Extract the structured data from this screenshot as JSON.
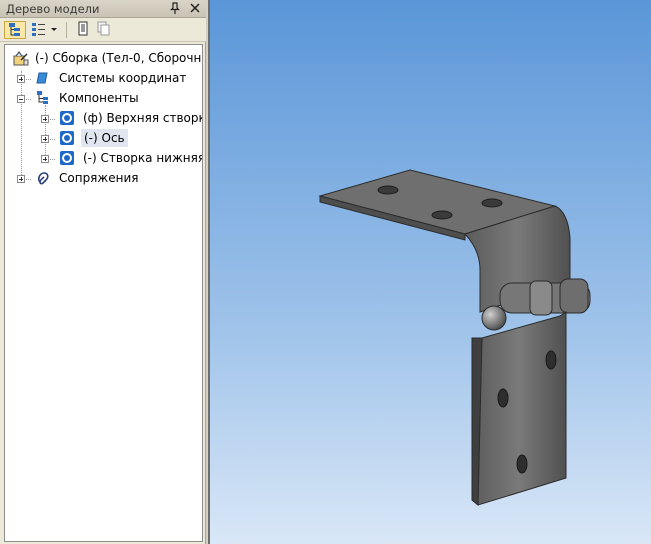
{
  "panel": {
    "title": "Дерево модели",
    "pin_icon": "pin-icon",
    "close_icon": "close-icon",
    "toolbar": {
      "tree_view_icon": "tree-structure-icon",
      "list_view_icon": "list-view-icon",
      "dropdown_icon": "chevron-down-icon",
      "properties_icon": "document-icon",
      "copy_icon": "document-copy-icon"
    }
  },
  "tree": {
    "root": {
      "label": "(-) Сборка (Тел-0, Сборочны",
      "icon": "assembly-icon"
    },
    "items": [
      {
        "label": "Системы координат",
        "icon": "coordinate-systems-icon",
        "expanded": false
      },
      {
        "label": "Компоненты",
        "icon": "components-icon",
        "expanded": true
      },
      {
        "label": "(ф) Верхняя створка",
        "icon": "part-icon",
        "expanded": false
      },
      {
        "label": "(-) Ось",
        "icon": "part-icon",
        "expanded": false,
        "selected": true
      },
      {
        "label": "(-) Створка нижняя",
        "icon": "part-icon",
        "expanded": false
      },
      {
        "label": "Сопряжения",
        "icon": "constraints-icon",
        "expanded": false
      }
    ]
  },
  "viewport": {
    "content": "3D hinge assembly model"
  }
}
